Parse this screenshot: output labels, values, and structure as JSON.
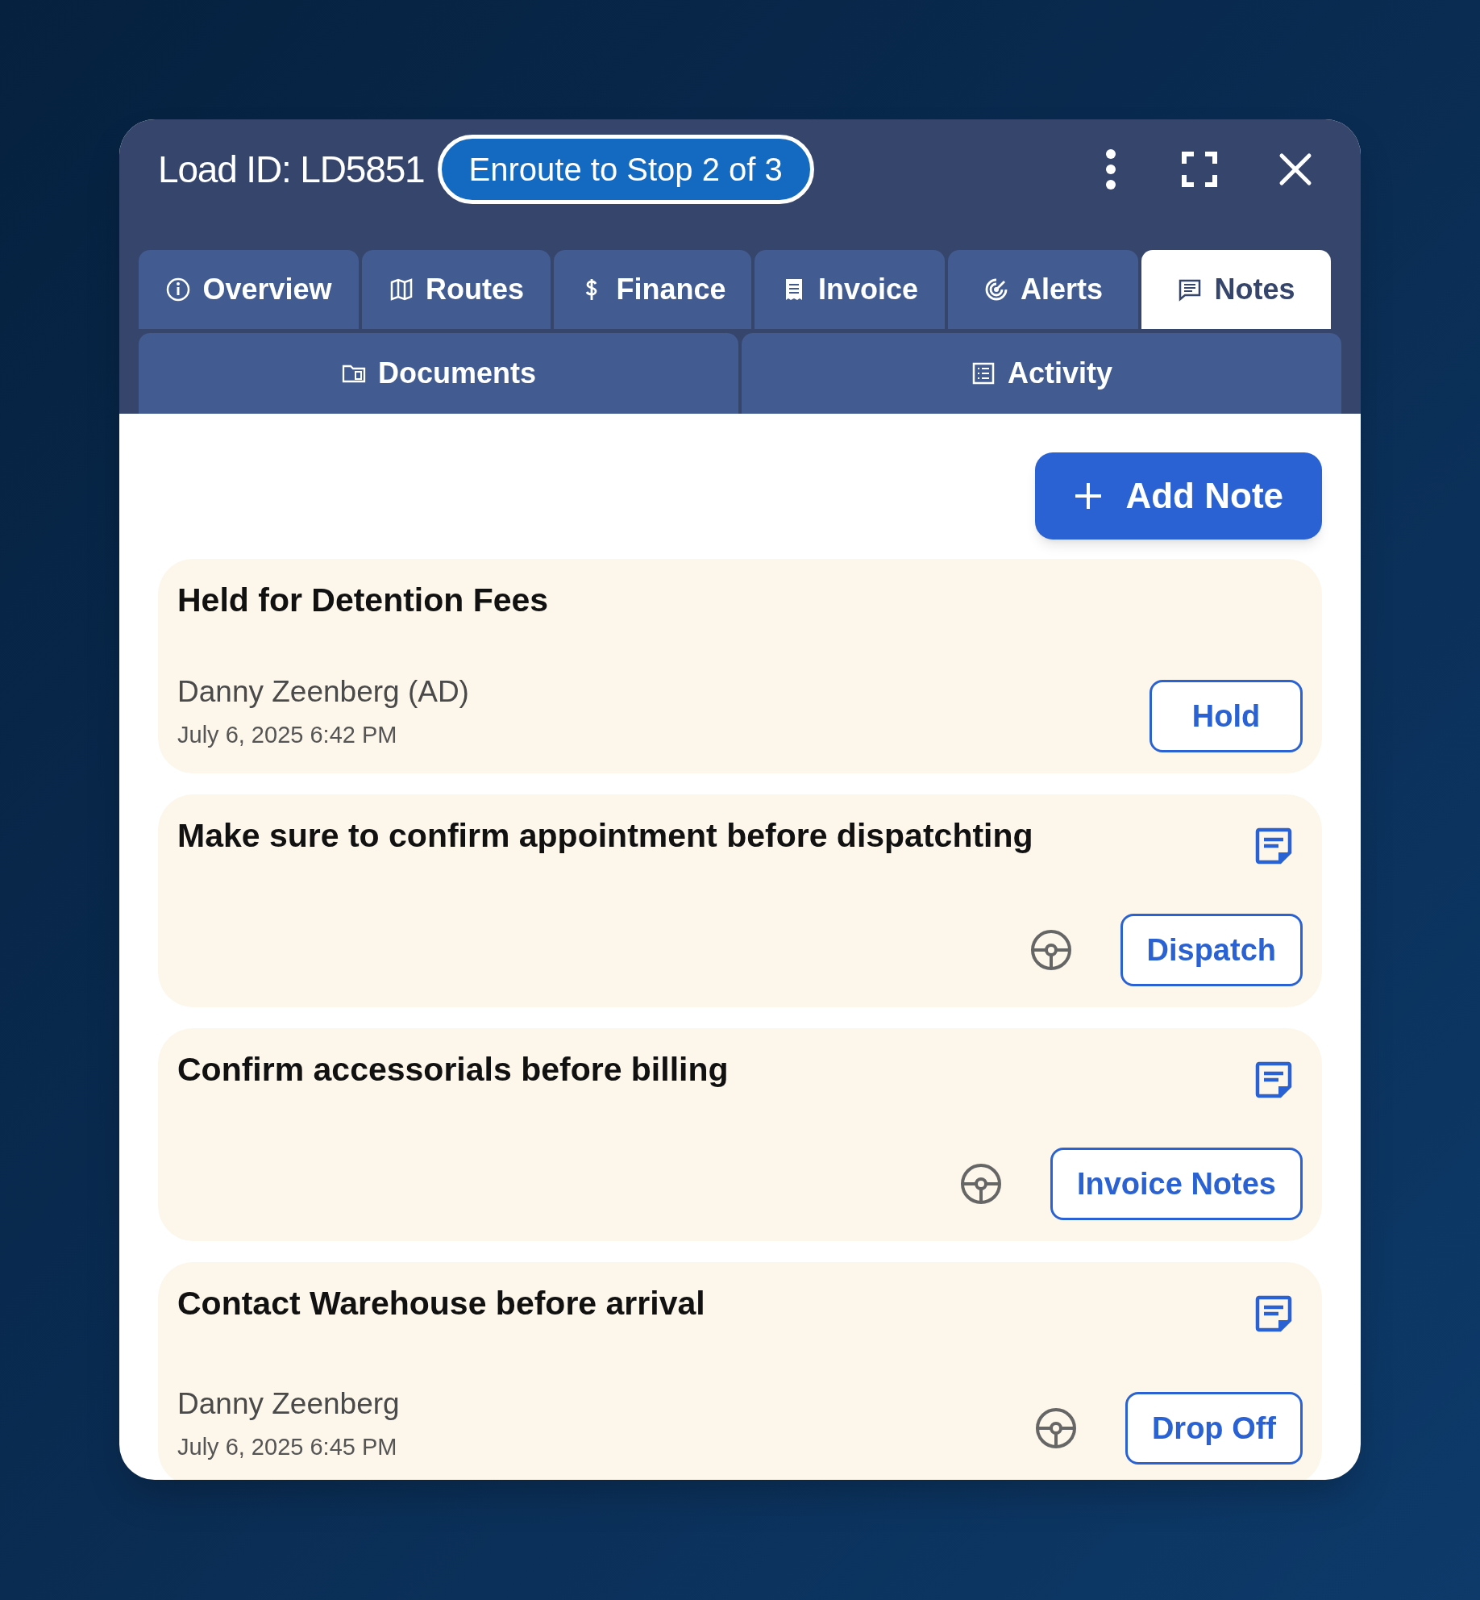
{
  "window": {
    "title": "Load ID: LD5851",
    "status": "Enroute to Stop 2 of 3"
  },
  "tabs": [
    {
      "label": "Overview",
      "selected": false
    },
    {
      "label": "Routes",
      "selected": false
    },
    {
      "label": "Finance",
      "selected": false
    },
    {
      "label": "Invoice",
      "selected": false
    },
    {
      "label": "Alerts",
      "selected": false
    },
    {
      "label": "Notes",
      "selected": true
    },
    {
      "label": "Documents",
      "selected": false
    },
    {
      "label": "Activity",
      "selected": false
    }
  ],
  "add_button": "Add Note",
  "notes": [
    {
      "title": "Held for Detention Fees",
      "author": "Danny Zeenberg (AD)",
      "time": "July 6, 2025 6:42 PM",
      "tag": "Hold",
      "note_icon": false,
      "driver_icon": false
    },
    {
      "title": "Make sure to confirm appointment before dispatchting",
      "tag": "Dispatch",
      "note_icon": true,
      "driver_icon": true
    },
    {
      "title": "Confirm accessorials before billing",
      "tag": "Invoice Notes",
      "note_icon": true,
      "driver_icon": true
    },
    {
      "title": "Contact Warehouse before arrival",
      "author": "Danny Zeenberg",
      "time": "July 6, 2025 6:45 PM",
      "tag": "Drop Off",
      "note_icon": true,
      "driver_icon": true
    }
  ]
}
